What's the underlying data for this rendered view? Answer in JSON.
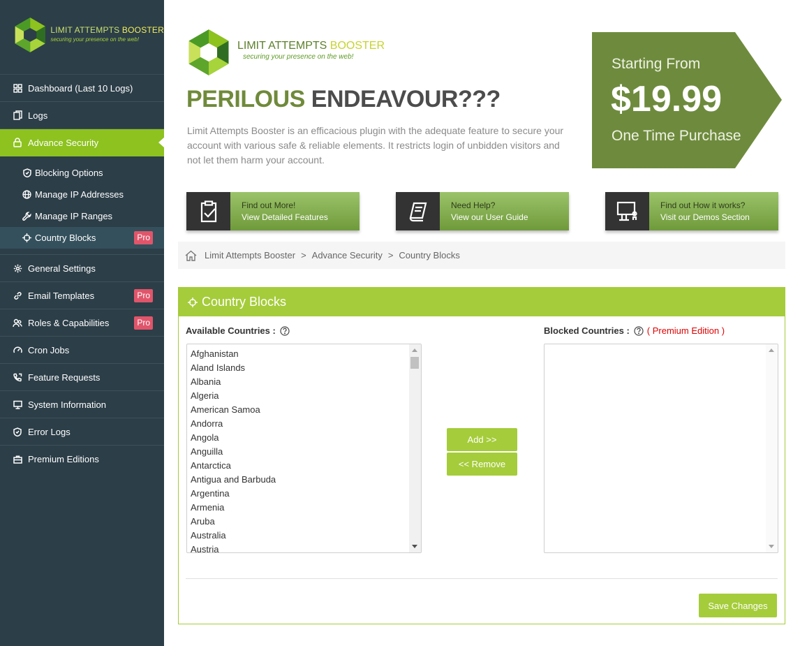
{
  "colors": {
    "sidebar_bg": "#2c3e48",
    "accent": "#a5cc3a",
    "active_menu": "#8dc21f",
    "pro_badge": "#e0556a",
    "price_box": "#6e8b3d",
    "premium_text": "#e00000"
  },
  "sidebar": {
    "logo": {
      "title_part1": "LIMIT ATTEMPTS ",
      "title_part2": "BOOSTER",
      "tagline": "securing your presence on the web!"
    },
    "menu": [
      {
        "label": "Dashboard (Last 10 Logs)",
        "icon": "dashboard-icon"
      },
      {
        "label": "Logs",
        "icon": "logs-icon"
      },
      {
        "label": "Advance Security",
        "icon": "lock-icon",
        "active": true
      }
    ],
    "submenu": [
      {
        "label": "Blocking Options",
        "icon": "shield-icon"
      },
      {
        "label": "Manage IP Addresses",
        "icon": "globe-icon"
      },
      {
        "label": "Manage IP Ranges",
        "icon": "wrench-icon"
      },
      {
        "label": "Country Blocks",
        "icon": "crosshair-icon",
        "badge": "Pro",
        "current": true
      }
    ],
    "menu2": [
      {
        "label": "General Settings",
        "icon": "gear-icon"
      },
      {
        "label": "Email Templates",
        "icon": "link-icon",
        "badge": "Pro"
      },
      {
        "label": "Roles & Capabilities",
        "icon": "users-icon",
        "badge": "Pro"
      },
      {
        "label": "Cron Jobs",
        "icon": "gauge-icon"
      },
      {
        "label": "Feature Requests",
        "icon": "phone-icon"
      },
      {
        "label": "System Information",
        "icon": "monitor-icon"
      },
      {
        "label": "Error Logs",
        "icon": "shield-icon"
      },
      {
        "label": "Premium Editions",
        "icon": "briefcase-icon"
      }
    ]
  },
  "banner": {
    "logo_title_part1": "LIMIT ATTEMPTS ",
    "logo_title_part2": "BOOSTER",
    "logo_tagline": "securing your presence on the web!",
    "headline_part1": "PERILOUS",
    "headline_part2": "ENDEAVOUR???",
    "blurb": "Limit Attempts Booster is an efficacious plugin with the adequate feature to secure your account with various safe & reliable elements. It restricts login of unbidden visitors and not let them harm your account.",
    "price_from": "Starting From",
    "price": "$19.99",
    "price_note": "One Time Purchase"
  },
  "feature_buttons": [
    {
      "top": "Find out More!",
      "bottom": "View Detailed Features",
      "icon": "clipboard-check-icon"
    },
    {
      "top": "Need Help?",
      "bottom": "View our User Guide",
      "icon": "book-icon"
    },
    {
      "top": "Find out How it works?",
      "bottom": "Visit our Demos Section",
      "icon": "presentation-icon"
    }
  ],
  "breadcrumb": [
    "Limit Attempts Booster",
    "Advance Security",
    "Country Blocks"
  ],
  "panel": {
    "title": "Country Blocks",
    "available_label": "Available Countries :",
    "blocked_label": "Blocked Countries :",
    "premium_note": "( Premium Edition )",
    "available_countries": [
      "Afghanistan",
      "Aland Islands",
      "Albania",
      "Algeria",
      "American Samoa",
      "Andorra",
      "Angola",
      "Anguilla",
      "Antarctica",
      "Antigua and Barbuda",
      "Argentina",
      "Armenia",
      "Aruba",
      "Australia",
      "Austria"
    ],
    "blocked_countries": [],
    "add_label": "Add >>",
    "remove_label": "<< Remove",
    "save_label": "Save Changes"
  }
}
